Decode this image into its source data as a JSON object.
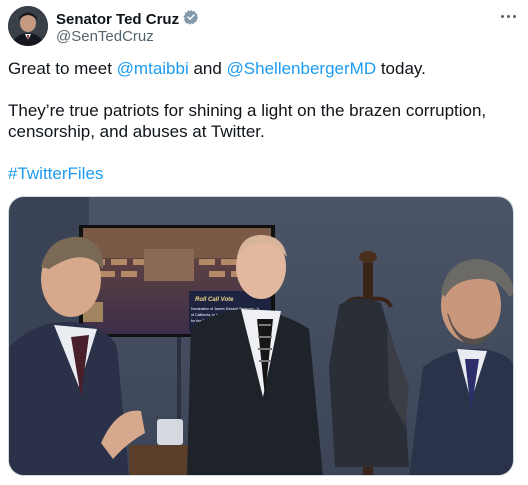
{
  "author": {
    "display_name": "Senator Ted Cruz",
    "handle": "@SenTedCruz",
    "verified_icon": "verified-badge-icon",
    "verified_color": "#829aab"
  },
  "tweet": {
    "line1_pre": "Great to meet ",
    "mention1": "@mtaibbi",
    "line1_mid": " and ",
    "mention2": "@ShellenbergerMD",
    "line1_post": " today.",
    "line2": "They’re true patriots for shining a light on the brazen corruption,",
    "line3": "censorship, and abuses at Twitter.",
    "hashtag": "#TwitterFiles"
  },
  "media": {
    "tv_banner": "Roll Call Vote",
    "tv_caption_1": "Nomination of James Edward Simmons, Jr.",
    "tv_caption_2": "of California, to be U.S. District Judge",
    "tv_caption_3": "for the Southern District of Cali"
  },
  "colors": {
    "link": "#1d9bf0",
    "text": "#0f1419",
    "secondary": "#536471"
  }
}
